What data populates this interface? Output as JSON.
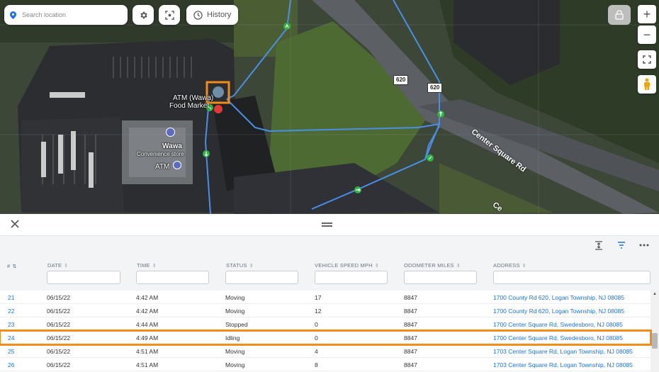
{
  "map": {
    "search_placeholder": "Search location",
    "history_label": "History",
    "labels": {
      "atm_wawa": "ATM (Wawa)",
      "food_market": "Food Market",
      "wawa": "Wawa",
      "convenience": "Convenience store",
      "atm": "ATM",
      "route_620_a": "620",
      "route_620_b": "620",
      "center_square_rd": "Center Square Rd",
      "center_square_rd_cut": "Ce"
    },
    "zoom_in": "+",
    "zoom_out": "−",
    "colors": {
      "route": "#4a8fe7",
      "arrow": "#2fb344",
      "stop": "#e53935",
      "selection": "#f28c1b"
    }
  },
  "grid": {
    "columns": {
      "num": "#",
      "date": "DATE",
      "time": "TIME",
      "status": "STATUS",
      "speed": "VEHICLE SPEED MPH",
      "odometer": "ODOMETER MILES",
      "address": "ADDRESS"
    },
    "rows": [
      {
        "num": "21",
        "date": "06/15/22",
        "time": "4:42 AM",
        "status": "Moving",
        "speed": "17",
        "odometer": "8847",
        "address": "1700 County Rd 620, Logan Township, NJ 08085"
      },
      {
        "num": "22",
        "date": "06/15/22",
        "time": "4:42 AM",
        "status": "Moving",
        "speed": "12",
        "odometer": "8847",
        "address": "1700 County Rd 620, Logan Township, NJ 08085"
      },
      {
        "num": "23",
        "date": "06/15/22",
        "time": "4:44 AM",
        "status": "Stopped",
        "speed": "0",
        "odometer": "8847",
        "address": "1700 Center Square Rd, Swedesboro, NJ 08085"
      },
      {
        "num": "24",
        "date": "06/15/22",
        "time": "4:49 AM",
        "status": "Idling",
        "speed": "0",
        "odometer": "8847",
        "address": "1700 Center Square Rd, Swedesboro, NJ 08085"
      },
      {
        "num": "25",
        "date": "06/15/22",
        "time": "4:51 AM",
        "status": "Moving",
        "speed": "4",
        "odometer": "8847",
        "address": "1703 Center Square Rd, Logan Township, NJ 08085"
      },
      {
        "num": "26",
        "date": "06/15/22",
        "time": "4:51 AM",
        "status": "Moving",
        "speed": "8",
        "odometer": "8847",
        "address": "1703 Center Square Rd, Logan Township, NJ 08085"
      }
    ]
  }
}
